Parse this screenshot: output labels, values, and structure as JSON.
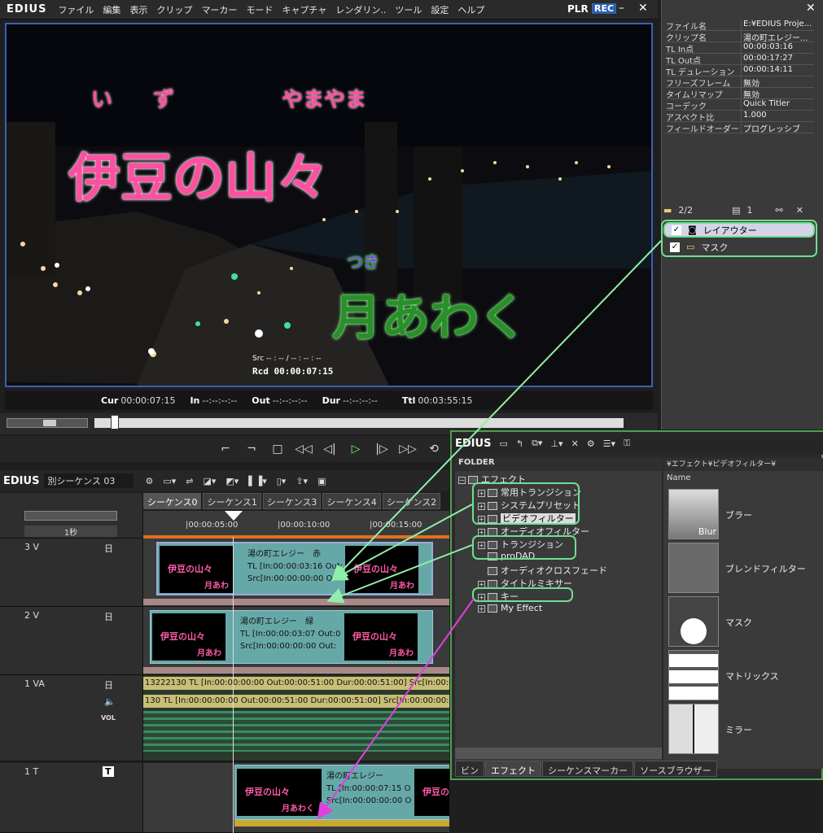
{
  "app": {
    "logo": "EDIUS",
    "menus": [
      "ファイル",
      "編集",
      "表示",
      "クリップ",
      "マーカー",
      "モード",
      "キャプチャ",
      "レンダリン..",
      "ツール",
      "設定",
      "ヘルプ"
    ],
    "plr": "PLR",
    "rec": "REC"
  },
  "preview": {
    "ruby1a": "い",
    "ruby1b": "ず",
    "ruby1c": "やまやま",
    "title1": "伊豆の山々",
    "ruby2": "つき",
    "title2": "月あわく",
    "src": "Src -- : -- / -- : -- : --",
    "rec": "Rcd 00:00:07:15"
  },
  "timecodes": {
    "cur_label": "Cur",
    "cur": "00:00:07:15",
    "in_label": "In",
    "in": "--:--:--:--",
    "out_label": "Out",
    "out": "--:--:--:--",
    "dur_label": "Dur",
    "dur": "--:--:--:--",
    "ttl_label": "Ttl",
    "ttl": "00:03:55:15"
  },
  "info": [
    [
      "ファイル名",
      "E:¥EDIUS Proje..."
    ],
    [
      "クリップ名",
      "湯の町エレジー..."
    ],
    [
      "TL In点",
      "00:00:03:16"
    ],
    [
      "TL Out点",
      "00:00:17:27"
    ],
    [
      "TL デュレーション",
      "00:00:14:11"
    ],
    [
      "フリーズフレーム",
      "無効"
    ],
    [
      "タイムリマップ",
      "無効"
    ],
    [
      "コーデック",
      "Quick Titler"
    ],
    [
      "アスペクト比",
      "1.000"
    ],
    [
      "フィールドオーダー",
      "プログレッシブ"
    ]
  ],
  "fxbar": {
    "count": "2/2",
    "num": "1"
  },
  "layers": [
    {
      "label": "レイアウター"
    },
    {
      "label": "マスク"
    }
  ],
  "timeline": {
    "logo": "EDIUS",
    "seq": "別シーケンス 03",
    "scale": "1秒",
    "tabs": [
      "シーケンス0",
      "シーケンス1",
      "シーケンス3",
      "シーケンス4",
      "シーケンス2"
    ],
    "ticks": [
      "|00:00:05:00",
      "|00:00:10:00",
      "|00:00:15:00"
    ]
  },
  "tracks": {
    "v3": "3 V",
    "v2": "2 V",
    "va1": "1 VA",
    "t1": "1 T",
    "vol": "VOL"
  },
  "clips": {
    "v3": {
      "l1": "湯の町エレジー　赤",
      "l2": "TL [In:00:00:03:16 Out:",
      "l3": "Src[In:00:00:00:00 Ou"
    },
    "v2": {
      "l1": "湯の町エレジー　緑",
      "l2": "TL [In:00:00:03:07 Out:0",
      "l3": "Src[In:00:00:00:00 Out:"
    },
    "a1": "13222130  TL [In:00:00:00:00 Out:00:00:51:00 Dur:00:00:51:00]  Src[In:00:00:00",
    "a2": "130  TL [In:00:00:00:00 Out:00:00:51:00 Dur:00:00:51:00]  Src[In:00:00:00:00",
    "t1": {
      "l1": "湯の町エレジー",
      "l2": "TL [In:00:00:07:15 O",
      "l3": "Src[In:00:00:00:00 O"
    },
    "thumb1": "伊豆の山々",
    "thumb2": "月あわく"
  },
  "fx": {
    "logo": "EDIUS",
    "folder": "FOLDER",
    "root": "エフェクト",
    "path": "¥エフェクト¥ビデオフィルター¥",
    "name": "Name",
    "tree": [
      "常用トランジション",
      "システムプリセット",
      "ビデオフィルター",
      "オーディオフィルター",
      "トランジション",
      "proDAD",
      "オーディオクロスフェード",
      "タイトルミキサー",
      "キー",
      "My Effect"
    ],
    "items": [
      "ブラー",
      "ブレンドフィルター",
      "マスク",
      "マトリックス",
      "ミラー"
    ],
    "blur": "Blur",
    "tabs": [
      "ビン",
      "エフェクト",
      "シーケンスマーカー",
      "ソースブラウザー"
    ]
  },
  "colors": {
    "accent": "#3a5fb5",
    "green": "#6fdf8f",
    "magenta": "#e040e0"
  }
}
